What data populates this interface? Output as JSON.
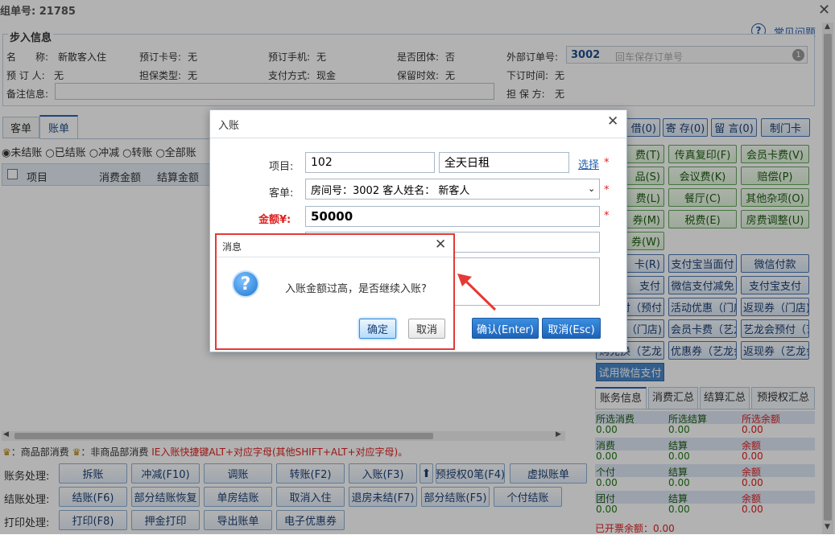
{
  "header": {
    "order_label": "组单号: 21785",
    "help": "常见问题"
  },
  "info": {
    "legend": "步入信息",
    "name_label": "名　　称:",
    "name_value": "新散客入住",
    "card_label": "预订卡号:",
    "card_value": "无",
    "phone_label": "预订手机:",
    "phone_value": "无",
    "group_label": "是否团体:",
    "group_value": "否",
    "ext_order_label": "外部订单号:",
    "ext_order_value": "3002",
    "ext_order_hint": "回车保存订单号",
    "ext_badge": "1",
    "booker_label": "预 订 人:",
    "booker_value": "无",
    "guarantee_label": "担保类型:",
    "guarantee_value": "无",
    "pay_label": "支付方式:",
    "pay_value": "现金",
    "hold_label": "保留时效:",
    "hold_value": "无",
    "order_time_label": "下订时间:",
    "order_time_value": "无",
    "remark_label": "备注信息:",
    "guarantor_label": "担 保 方:",
    "guarantor_value": "无"
  },
  "tabs": [
    {
      "label": "客单"
    },
    {
      "label": "账单"
    }
  ],
  "filters": [
    "未结账",
    "已结账",
    "冲减",
    "转账",
    "全部账"
  ],
  "table_headers": [
    "项目",
    "消费金额",
    "结算金额"
  ],
  "top_buttons": [
    "借(0)",
    "寄 存(0)",
    "留 言(0)",
    "制门卡"
  ],
  "green_buttons": [
    "费(T)",
    "传真复印(F)",
    "会员卡费(V)",
    "品(S)",
    "会议费(K)",
    "赔偿(P)",
    "费(L)",
    "餐厅(C)",
    "其他杂项(O)",
    "券(M)",
    "税费(E)",
    "房费调整(U)",
    "券(W)"
  ],
  "blue_buttons": [
    "卡(R)",
    "支付宝当面付",
    "微信付款",
    "支付",
    "微信支付减免",
    "支付宝支付",
    "付（预付",
    "活动优惠（门店",
    "返现券（门店)",
    "（门店)",
    "会员卡费（艺龙",
    "艺龙会预付（艺",
    "购兑换（艺龙",
    "优惠券（艺龙会",
    "返现券（艺龙会"
  ],
  "trial_button": "试用微信支付",
  "summary": {
    "tabs": [
      "账务信息",
      "消费汇总",
      "结算汇总",
      "预授权汇总"
    ],
    "rows": [
      {
        "c1": "所选消费",
        "c2": "所选结算",
        "c3": "所选余额",
        "v1": "0.00",
        "v2": "0.00",
        "v3": "0.00"
      },
      {
        "c1": "消费",
        "c2": "结算",
        "c3": "余额",
        "v1": "0.00",
        "v2": "0.00",
        "v3": "0.00"
      },
      {
        "c1": "个付",
        "c2": "结算",
        "c3": "余额",
        "v1": "0.00",
        "v2": "0.00",
        "v3": "0.00"
      },
      {
        "c1": "团付",
        "c2": "结算",
        "c3": "余额",
        "v1": "0.00",
        "v2": "0.00",
        "v3": "0.00"
      }
    ],
    "opened_label": "已开票余额：",
    "opened_value": "0.00"
  },
  "hint": {
    "prefix": "：商品部消费",
    "mid": "：非商品部消费",
    "red": "IE入账快捷键ALT+对应字母(其他SHIFT+ALT+对应字母)。"
  },
  "actions": {
    "row1_label": "账务处理:",
    "row1": [
      "拆账",
      "冲减(F10)",
      "调账",
      "转账(F2)",
      "入账(F3)",
      "预授权0笔(F4)",
      "虚拟账单"
    ],
    "row2_label": "结账处理:",
    "row2": [
      "结账(F6)",
      "部分结账恢复",
      "单房结账",
      "取消入住",
      "退房未结(F7)",
      "部分结账(F5)",
      "个付结账"
    ],
    "row3_label": "打印处理:",
    "row3": [
      "打印(F8)",
      "押金打印",
      "导出账单",
      "电子优惠券"
    ]
  },
  "entry_dialog": {
    "title": "入账",
    "item_label": "项目:",
    "item_code": "102",
    "item_name": "全天日租",
    "select_link": "选择",
    "bill_label": "客单:",
    "bill_value": "房间号：3002 客人姓名： 新客人",
    "amount_label": "金额¥:",
    "amount_value": "50000",
    "confirm_button": "确认(Enter)",
    "cancel_button": "取消(Esc)"
  },
  "msg_dialog": {
    "title": "消息",
    "text": "入账金额过高，是否继续入账?",
    "ok": "确定",
    "cancel": "取消"
  },
  "colors": {
    "accent": "#1f5fa8",
    "red": "#e02020",
    "green": "#1e7a12",
    "highlight": "#e53935"
  }
}
